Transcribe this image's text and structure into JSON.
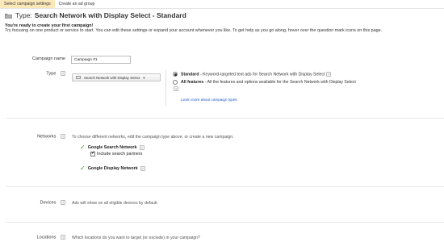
{
  "tabs": [
    {
      "label": "Select campaign settings",
      "active": true
    },
    {
      "label": "Create an ad group",
      "active": false
    }
  ],
  "header": {
    "type_label": "Type:",
    "type_value": "Search Network with Display Select - Standard",
    "icon": "folder-icon"
  },
  "intro": {
    "title": "You're ready to create your first campaign!",
    "body": "Try focusing on one product or service to start. You can edit these settings or expand your account whenever you like. To get help as you go along, hover over the question mark icons on this page."
  },
  "campaign_name": {
    "label": "Campaign name",
    "value": "Campaign #1"
  },
  "type_section": {
    "label": "Type",
    "help": "?",
    "select_value": "Search Network with Display Select",
    "options": [
      {
        "title": "Standard",
        "desc": " - Keyword-targeted text ads for Search Network with Display Select",
        "selected": true
      },
      {
        "title": "All features",
        "desc": " - All the features and options available for the Search Network with Display Select",
        "selected": false
      }
    ],
    "learn_more": "Learn more about campaign types"
  },
  "networks": {
    "label": "Networks",
    "help": "?",
    "hint": "To choose different networks, edit the campaign type above, or create a new campaign.",
    "search_network": "Google Search Network",
    "include_partners": "Include search partners",
    "include_partners_checked": true,
    "display_network": "Google Display Network"
  },
  "devices": {
    "label": "Devices",
    "help": "?",
    "text": "Ads will show on all eligible devices by default."
  },
  "locations": {
    "label": "Locations",
    "help": "?",
    "text": "Which locations do you want to target (or exclude) in your campaign?"
  },
  "colors": {
    "active_tab": "#fbe8b8",
    "check_green": "#3a9c22",
    "link_blue": "#1a55c6"
  }
}
